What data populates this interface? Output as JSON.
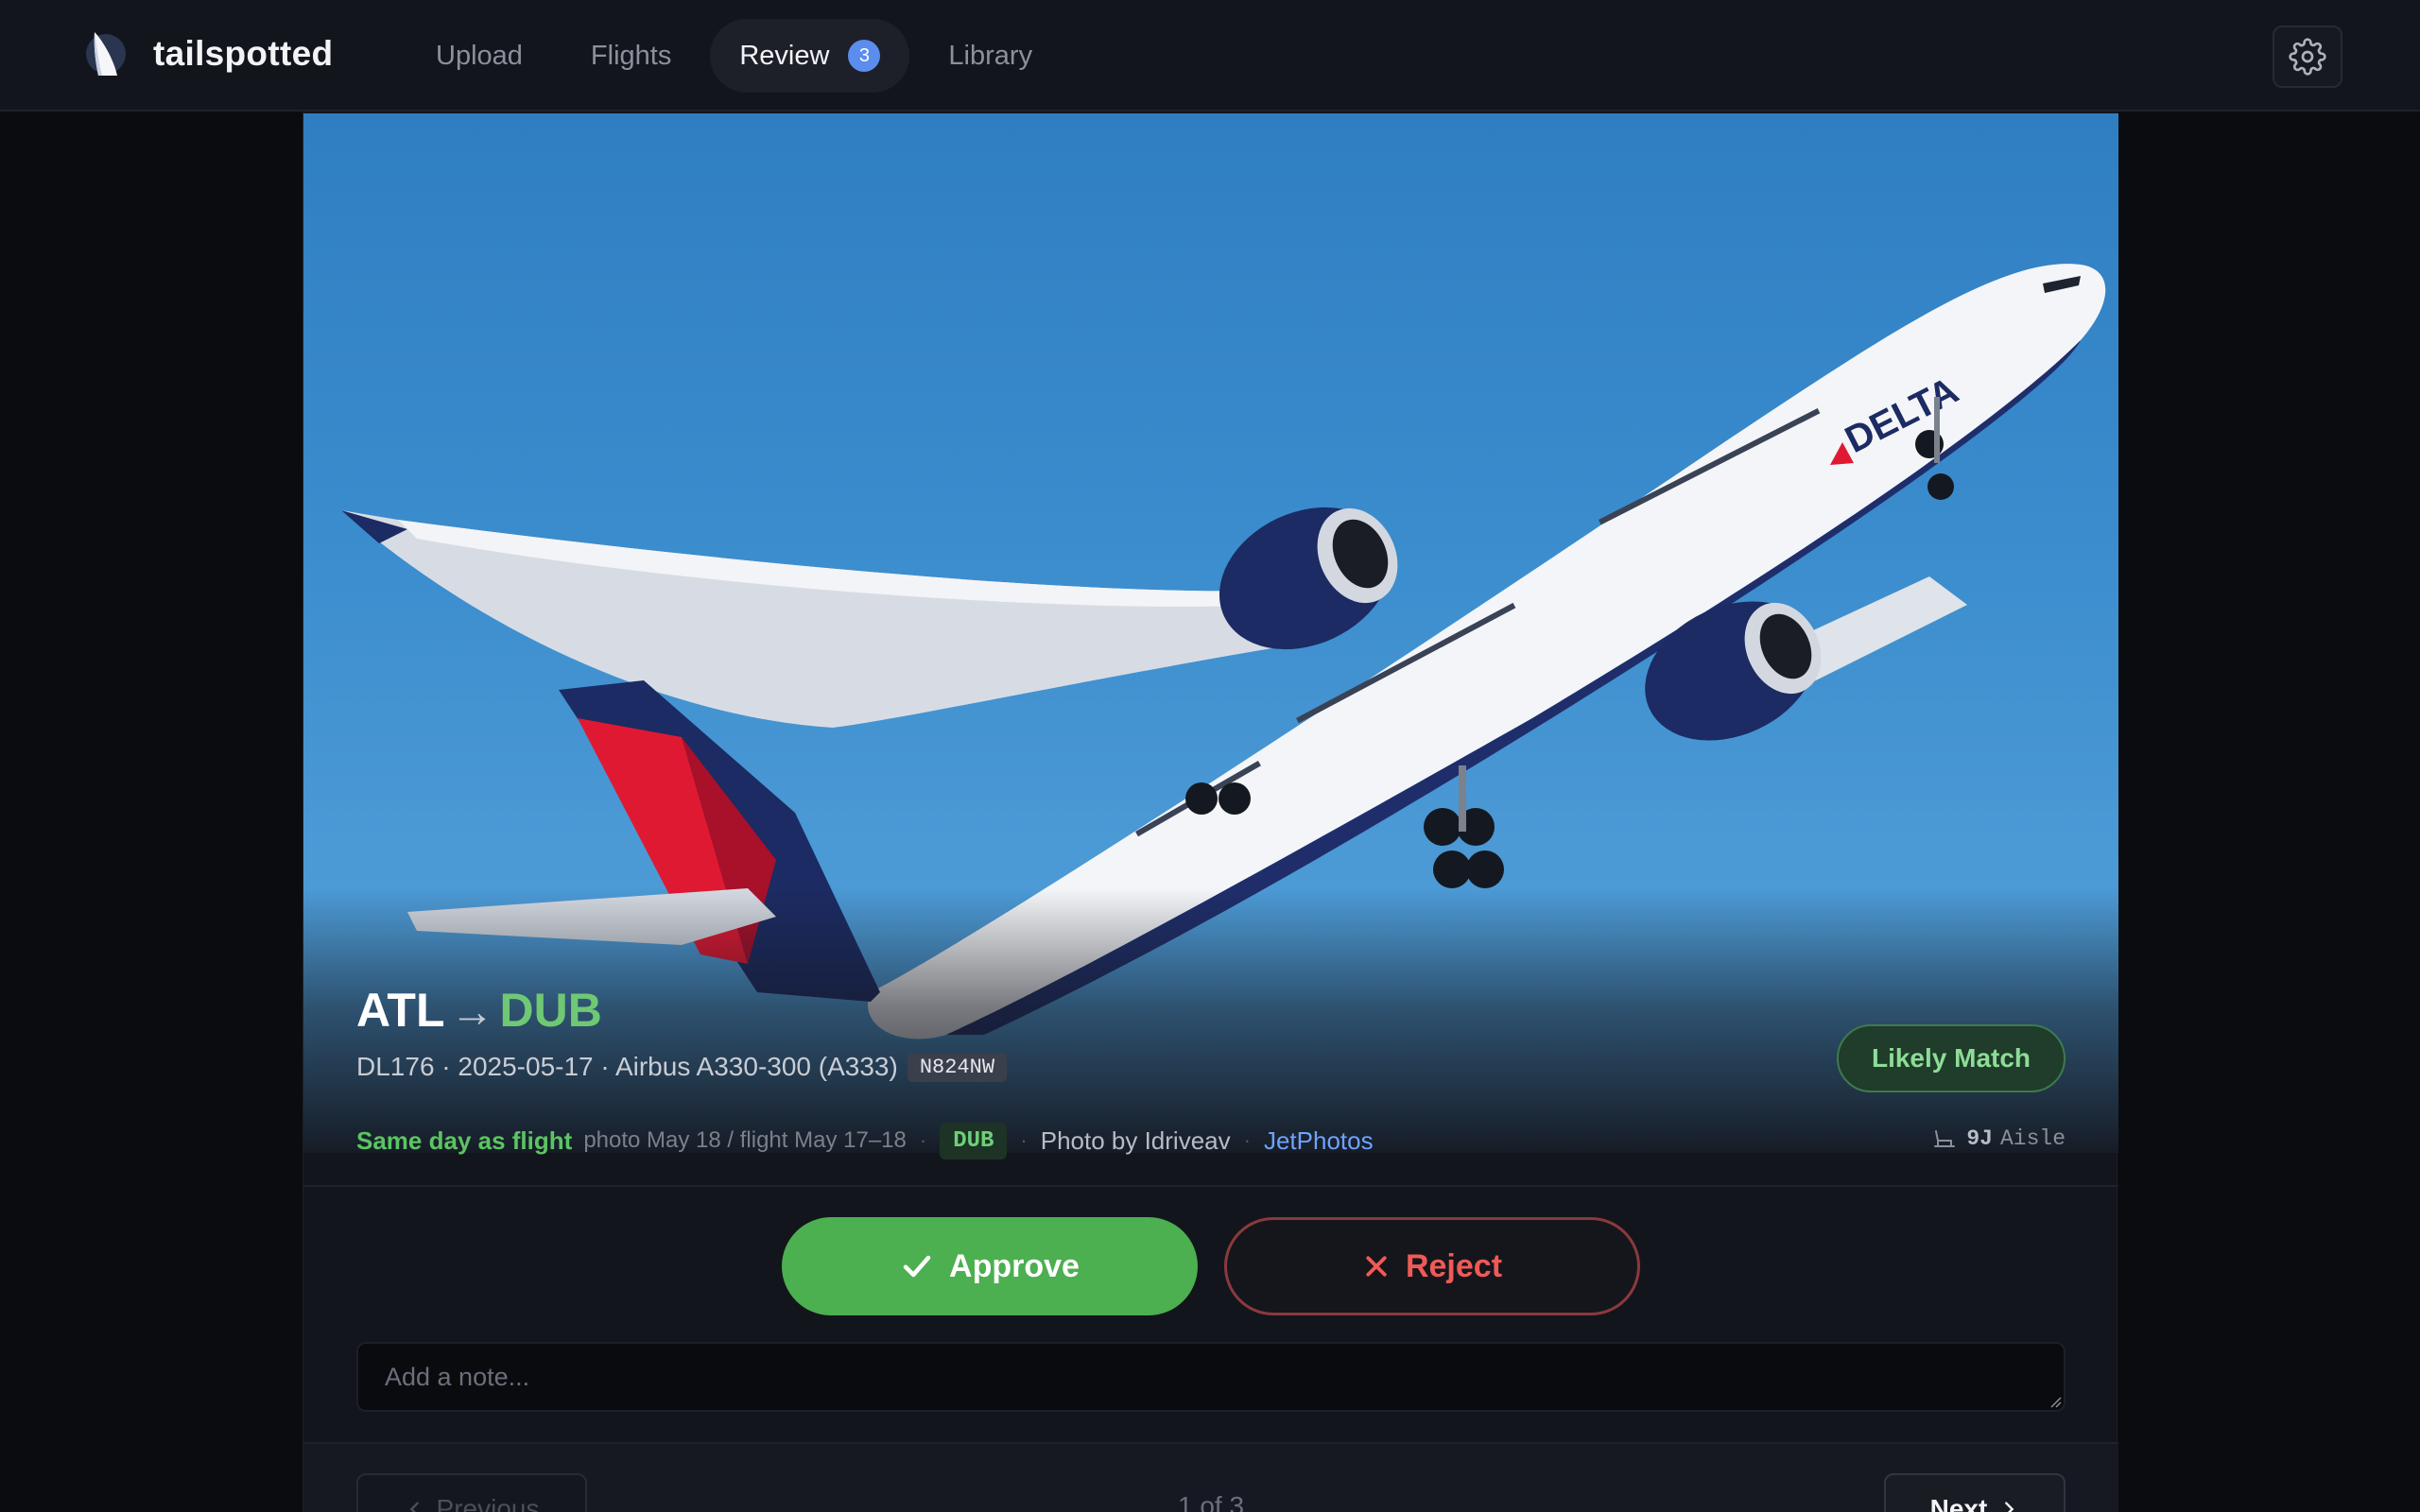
{
  "app": {
    "name": "tailspotted"
  },
  "nav": {
    "items": [
      {
        "label": "Upload"
      },
      {
        "label": "Flights"
      },
      {
        "label": "Review",
        "badge": "3",
        "active": true
      },
      {
        "label": "Library"
      }
    ]
  },
  "flight": {
    "from": "ATL",
    "arrow": "→",
    "to": "DUB",
    "details": "DL176 · 2025-05-17 · Airbus A330-300 (A333)",
    "registration": "N824NW",
    "match_status": "Likely Match",
    "photo_livery_text": "DELTA"
  },
  "info": {
    "same_day": "Same day as flight",
    "dates": "photo May 18 / flight May 17–18",
    "sep": "·",
    "airport": "DUB",
    "photo_by": "Photo by Idriveav",
    "source": "JetPhotos",
    "seat_number": "9J",
    "seat_type": "Aisle"
  },
  "actions": {
    "approve": "Approve",
    "reject": "Reject",
    "note_placeholder": "Add a note..."
  },
  "pager": {
    "previous": "Previous",
    "position": "1 of 3",
    "next": "Next"
  },
  "colors": {
    "accent": "#5b8def",
    "approve": "#4caf50",
    "reject": "#ef5a57",
    "match": "#8ddc97",
    "link": "#6ea3ff"
  },
  "icons": {
    "logo": "tail-fin-logo",
    "settings": "gear-icon",
    "approve": "check-icon",
    "reject": "close-icon",
    "seat": "seat-icon",
    "prev": "chevron-left-icon",
    "next": "chevron-right-icon"
  }
}
